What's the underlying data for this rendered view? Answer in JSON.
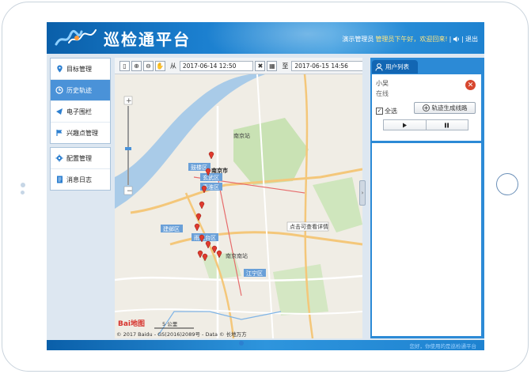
{
  "header": {
    "title": "巡检通平台",
    "user_role": "演示管理员",
    "greeting": "管理员下午好，欢迎回来!",
    "logout_label": "退出"
  },
  "sidebar": {
    "groups": [
      [
        {
          "label": "目标管理",
          "icon": "location-pin-icon"
        },
        {
          "label": "历史轨迹",
          "icon": "history-icon",
          "active": true
        },
        {
          "label": "电子围栏",
          "icon": "fence-icon"
        },
        {
          "label": "兴趣点管理",
          "icon": "flag-icon"
        }
      ],
      [
        {
          "label": "配置管理",
          "icon": "gear-icon"
        },
        {
          "label": "消息日志",
          "icon": "log-icon"
        }
      ]
    ]
  },
  "map_toolbar": {
    "from_label": "从",
    "start_time": "2017-06-14 12:50",
    "to_label": "至",
    "end_time": "2017-06-15 14:56"
  },
  "map": {
    "labels": {
      "nanjing_station": "南京站",
      "nanjing_city": "南京市",
      "gulou": "鼓楼区",
      "xuanwu": "玄武区",
      "qinhuai": "秦淮区",
      "jianye": "建邺区",
      "yuhuatai": "雨花台区",
      "jiangning": "江宁区",
      "south_station": "南京南站",
      "detail_link": "点击可查看详情",
      "copyright": "© 2017 Baidu - GS(2016)2089号 - Data © 长地万方",
      "scale": "5 公里",
      "brand": "Bai地图"
    }
  },
  "right_panel": {
    "tab_label": "用户列表",
    "user": {
      "name": "小吴",
      "status": "在线"
    },
    "select_all_label": "全选",
    "generate_label": "轨迹生成线路"
  },
  "footer": {
    "note": "您好，你使用的是巡检通平台"
  },
  "colors": {
    "header_blue": "#1b7fcf",
    "active_menu": "#4a92d8",
    "panel_blue": "#2c8ad6",
    "marker_red": "#e03a2e"
  }
}
